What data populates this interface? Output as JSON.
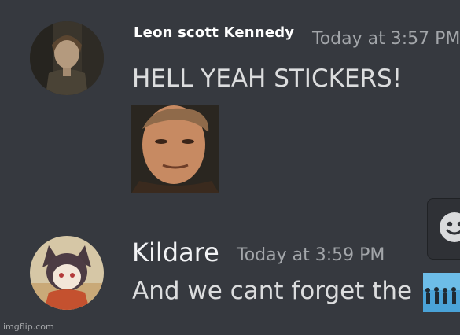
{
  "messages": [
    {
      "author": "Leon scott Kennedy",
      "timestamp": "Today at 3:57 PM",
      "text": "HELL YEAH STICKERS!",
      "avatar": "leon-kennedy-avatar",
      "attachment": "sticker"
    },
    {
      "author": "Kildare",
      "timestamp": "Today at 3:59 PM",
      "text": "And we cant forget the",
      "avatar": "anime-cat-avatar",
      "attachment": "inline-image"
    }
  ],
  "toolbar": {
    "reaction_icon": "smile-icon"
  },
  "watermark": "imgflip.com",
  "colors": {
    "background": "#36393f",
    "username": "#ffffff",
    "timestamp": "#a3a6aa",
    "message_text": "#dcddde"
  }
}
